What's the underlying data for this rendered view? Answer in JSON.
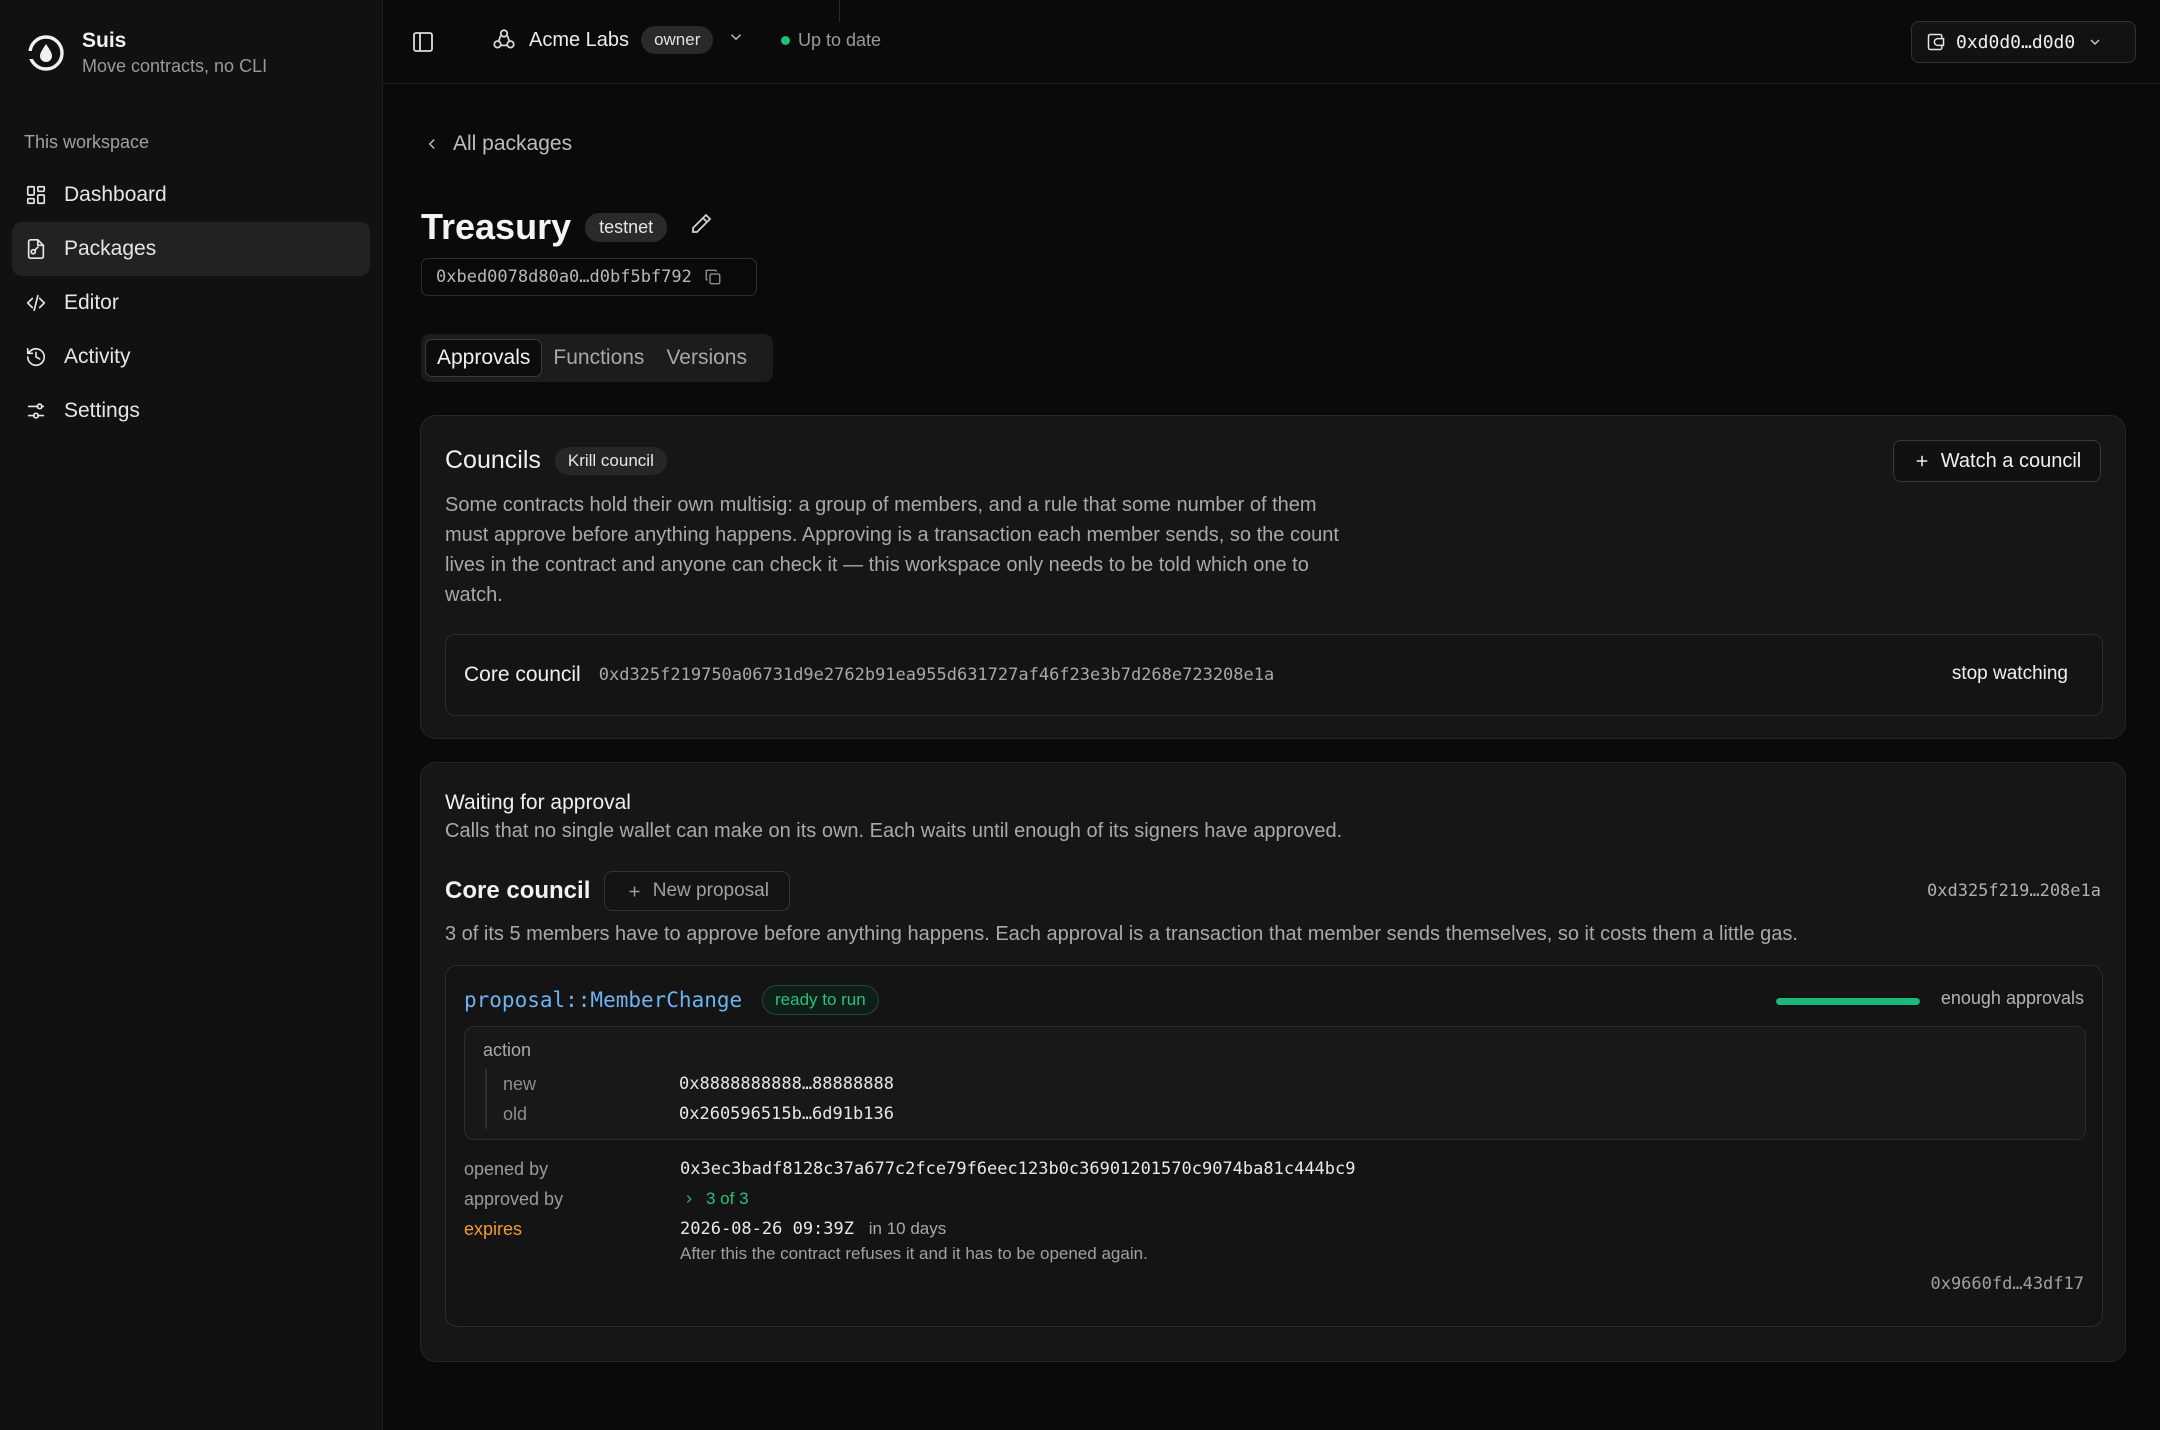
{
  "brand": {
    "title": "Suis",
    "subtitle": "Move contracts, no CLI"
  },
  "sidebar": {
    "section_label": "This workspace",
    "items": [
      {
        "label": "Dashboard",
        "icon": "dashboard-icon"
      },
      {
        "label": "Packages",
        "icon": "package-icon",
        "active": true
      },
      {
        "label": "Editor",
        "icon": "code-icon"
      },
      {
        "label": "Activity",
        "icon": "history-icon"
      },
      {
        "label": "Settings",
        "icon": "sliders-icon"
      }
    ]
  },
  "topbar": {
    "org_name": "Acme Labs",
    "role": "owner",
    "status": "Up to date",
    "wallet": "0xd0d0…d0d0"
  },
  "package": {
    "back_label": "All packages",
    "title": "Treasury",
    "network": "testnet",
    "address": "0xbed0078d80a0…d0bf5bf792",
    "tabs": [
      "Approvals",
      "Functions",
      "Versions"
    ]
  },
  "councils": {
    "title": "Councils",
    "badge": "Krill council",
    "watch_label": "Watch a council",
    "description": "Some contracts hold their own multisig: a group of members, and a rule that some number of them must approve before anything happens. Approving is a transaction each member sends, so the count lives in the contract and anyone can check it — this workspace only needs to be told which one to watch.",
    "rows": [
      {
        "name": "Core council",
        "address": "0xd325f219750a06731d9e2762b91ea955d631727af46f23e3b7d268e723208e1a",
        "action": "stop watching"
      }
    ]
  },
  "waiting": {
    "title": "Waiting for approval",
    "subtitle": "Calls that no single wallet can make on its own. Each waits until enough of its signers have approved.",
    "council_name": "Core council",
    "new_proposal_label": "New proposal",
    "council_address": "0xd325f219…208e1a",
    "council_desc": "3 of its 5 members have to approve before anything happens. Each approval is a transaction that member sends themselves, so it costs them a little gas.",
    "proposal": {
      "name": "proposal::MemberChange",
      "status": "ready to run",
      "progress": 1.0,
      "progress_label": "enough approvals",
      "action_label": "action",
      "action_fields": [
        {
          "key": "new",
          "value": "0x8888888888…88888888"
        },
        {
          "key": "old",
          "value": "0x260596515b…6d91b136"
        }
      ],
      "opened_by_label": "opened by",
      "opened_by": "0x3ec3badf8128c37a677c2fce79f6eec123b0c36901201570c9074ba81c444bc9",
      "approved_by_label": "approved by",
      "approved_by": "3 of 3",
      "expires_label": "expires",
      "expires_date": "2026-08-26 09:39Z",
      "expires_relative": "in 10 days",
      "expires_note": "After this the contract refuses it and it has to be opened again.",
      "hash": "0x9660fd…43df17"
    }
  },
  "colors": {
    "accent_green": "#27c27f",
    "link_blue": "#6db3ee",
    "warn_orange": "#f39a2c"
  }
}
